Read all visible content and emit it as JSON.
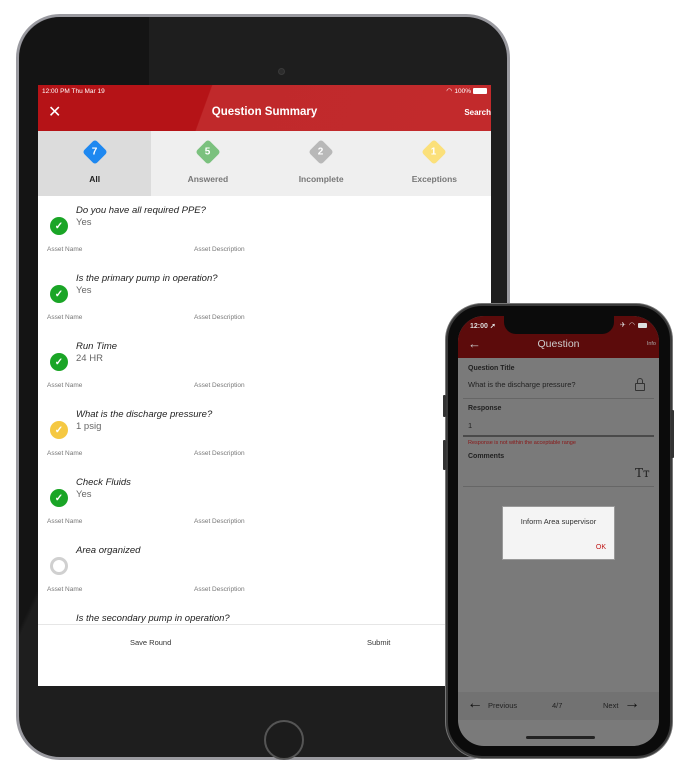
{
  "tablet": {
    "status_bar": {
      "time_date": "12:00 PM  Thu Mar 19",
      "battery": "100%"
    },
    "nav": {
      "close_icon": "close-icon",
      "title": "Question Summary",
      "search_label": "Search"
    },
    "tabs": [
      {
        "label": "All",
        "count": "7",
        "color": "#1e88f0",
        "active": true
      },
      {
        "label": "Answered",
        "count": "5",
        "color": "#7bc17e",
        "active": false
      },
      {
        "label": "Incomplete",
        "count": "2",
        "color": "#b8b8b8",
        "active": false
      },
      {
        "label": "Exceptions",
        "count": "1",
        "color": "#fbe07a",
        "active": false
      }
    ],
    "questions": [
      {
        "question": "Do you have all required PPE?",
        "answer": "Yes",
        "status": "done",
        "asset_name": "Asset Name",
        "asset_description": "Asset Description"
      },
      {
        "question": "Is the primary pump in operation?",
        "answer": "Yes",
        "status": "done",
        "asset_name": "Asset Name",
        "asset_description": "Asset Description"
      },
      {
        "question": "Run Time",
        "answer": "24 HR",
        "status": "done",
        "asset_name": "Asset Name",
        "asset_description": "Asset Description"
      },
      {
        "question": "What is the discharge pressure?",
        "answer": "1 psig",
        "status": "warn",
        "asset_name": "Asset Name",
        "asset_description": "Asset Description"
      },
      {
        "question": "Check Fluids",
        "answer": "Yes",
        "status": "done",
        "asset_name": "Asset Name",
        "asset_description": "Asset Description"
      },
      {
        "question": "Area organized",
        "answer": "",
        "status": "empty",
        "asset_name": "Asset Name",
        "asset_description": "Asset Description"
      },
      {
        "question": "Is the secondary pump in operation?",
        "answer": "",
        "status": "",
        "asset_name": "",
        "asset_description": ""
      }
    ],
    "footer": {
      "save_label": "Save Round",
      "submit_label": "Submit"
    }
  },
  "phone": {
    "status_bar": {
      "time": "12:00 ➚"
    },
    "nav": {
      "back_icon": "arrow-left-icon",
      "title": "Question",
      "info_label": "Info"
    },
    "question_title_label": "Question Title",
    "question_title_value": "What is the discharge pressure?",
    "response_label": "Response",
    "response_value": "1",
    "error_message": "Response is not within the acceptable range",
    "comments_label": "Comments",
    "dialog": {
      "message": "Inform Area supervisor",
      "ok_label": "OK"
    },
    "bottom_nav": {
      "previous_label": "Previous",
      "page_indicator": "4/7",
      "next_label": "Next"
    }
  },
  "colors": {
    "brand_red": "#b51317",
    "done_green": "#1aa526",
    "warn_yellow": "#f5c842",
    "error_red": "#8a1515"
  }
}
